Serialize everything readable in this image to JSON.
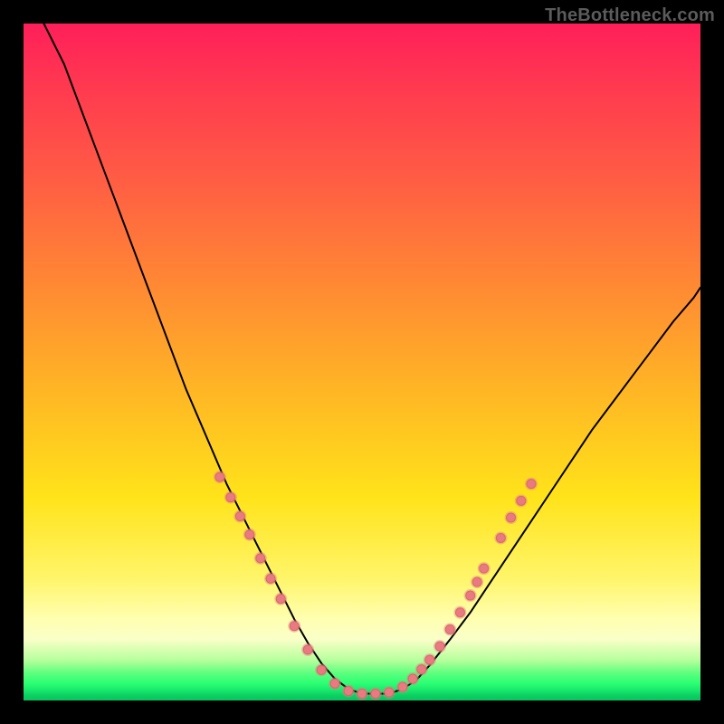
{
  "watermark": "TheBottleneck.com",
  "chart_data": {
    "type": "line",
    "title": "",
    "xlabel": "",
    "ylabel": "",
    "xlim": [
      0,
      100
    ],
    "ylim": [
      0,
      100
    ],
    "axes_visible": false,
    "grid": false,
    "background_gradient": {
      "orientation": "vertical",
      "stops": [
        {
          "pos": 0.0,
          "color": "#ff1f5a"
        },
        {
          "pos": 0.1,
          "color": "#ff3b4f"
        },
        {
          "pos": 0.22,
          "color": "#ff5a45"
        },
        {
          "pos": 0.38,
          "color": "#ff8734"
        },
        {
          "pos": 0.55,
          "color": "#ffb824"
        },
        {
          "pos": 0.7,
          "color": "#ffe31a"
        },
        {
          "pos": 0.82,
          "color": "#fff56a"
        },
        {
          "pos": 0.88,
          "color": "#ffffb0"
        },
        {
          "pos": 0.91,
          "color": "#f9ffc7"
        },
        {
          "pos": 0.94,
          "color": "#b8ff9d"
        },
        {
          "pos": 0.97,
          "color": "#2bff73"
        },
        {
          "pos": 1.0,
          "color": "#07c45e"
        }
      ]
    },
    "series": [
      {
        "name": "bottleneck-curve",
        "stroke": "#000000",
        "stroke_width": 2,
        "x": [
          3,
          6,
          9,
          12,
          15,
          18,
          21,
          24,
          27,
          30,
          33,
          36,
          38,
          40,
          42,
          44,
          46,
          48,
          50,
          52,
          54,
          56,
          58,
          60,
          63,
          66,
          69,
          72,
          75,
          78,
          81,
          84,
          87,
          90,
          93,
          96,
          99,
          100
        ],
        "y": [
          100,
          94,
          86,
          78,
          70,
          62,
          54,
          46,
          39,
          32,
          26,
          20,
          16,
          12,
          8.5,
          5.5,
          3.2,
          1.7,
          1.0,
          1.0,
          1.0,
          1.7,
          3.0,
          5.2,
          9.0,
          13,
          17.5,
          22,
          26.5,
          31,
          35.5,
          40,
          44,
          48,
          52,
          56,
          59.5,
          61
        ]
      }
    ],
    "markers": {
      "name": "highlighted-points",
      "color": "#e97a80",
      "stroke": "#d46a70",
      "radius_outer": 7,
      "radius_inner": 5,
      "points": [
        {
          "x": 29.0,
          "y": 33.0
        },
        {
          "x": 30.6,
          "y": 30.0
        },
        {
          "x": 32.0,
          "y": 27.2
        },
        {
          "x": 33.4,
          "y": 24.5
        },
        {
          "x": 35.0,
          "y": 21.0
        },
        {
          "x": 36.5,
          "y": 18.0
        },
        {
          "x": 38.0,
          "y": 15.0
        },
        {
          "x": 40.0,
          "y": 11.0
        },
        {
          "x": 42.0,
          "y": 7.5
        },
        {
          "x": 44.0,
          "y": 4.5
        },
        {
          "x": 46.0,
          "y": 2.5
        },
        {
          "x": 48.0,
          "y": 1.4
        },
        {
          "x": 50.0,
          "y": 1.0
        },
        {
          "x": 52.0,
          "y": 1.0
        },
        {
          "x": 54.0,
          "y": 1.2
        },
        {
          "x": 56.0,
          "y": 2.0
        },
        {
          "x": 57.5,
          "y": 3.2
        },
        {
          "x": 58.8,
          "y": 4.6
        },
        {
          "x": 60.0,
          "y": 6.0
        },
        {
          "x": 61.5,
          "y": 8.0
        },
        {
          "x": 63.0,
          "y": 10.5
        },
        {
          "x": 64.5,
          "y": 13.0
        },
        {
          "x": 66.0,
          "y": 15.5
        },
        {
          "x": 67.0,
          "y": 17.5
        },
        {
          "x": 68.0,
          "y": 19.5
        },
        {
          "x": 70.5,
          "y": 24.0
        },
        {
          "x": 72.0,
          "y": 27.0
        },
        {
          "x": 73.5,
          "y": 29.5
        },
        {
          "x": 75.0,
          "y": 32.0
        }
      ]
    }
  }
}
